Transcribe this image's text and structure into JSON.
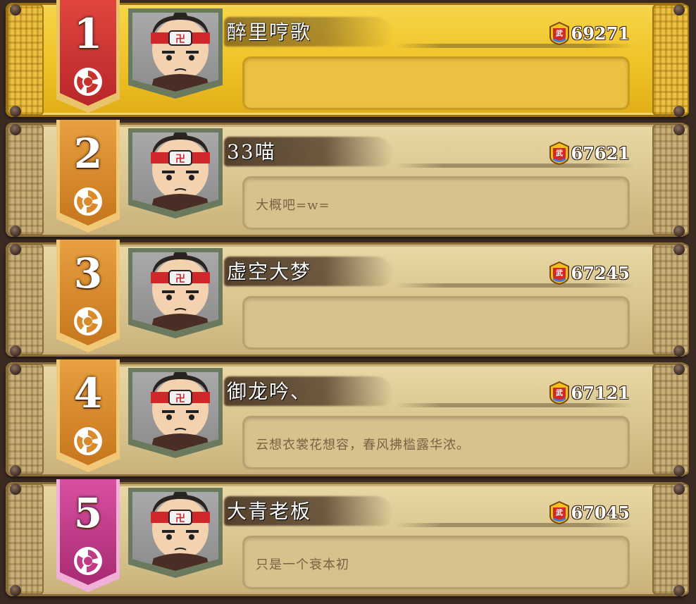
{
  "leaderboard": {
    "entries": [
      {
        "rank": "1",
        "name": "醉里哼歌",
        "score": "69271",
        "motto": "",
        "banner_color": "#c8322e",
        "banner_edge": "#e9c36a"
      },
      {
        "rank": "2",
        "name": "33喵",
        "score": "67621",
        "motto": "大概吧=w=",
        "banner_color": "#d98a2a",
        "banner_edge": "#f0c878"
      },
      {
        "rank": "3",
        "name": "虚空大梦",
        "score": "67245",
        "motto": "",
        "banner_color": "#d98a2a",
        "banner_edge": "#f0c878"
      },
      {
        "rank": "4",
        "name": "御龙吟、",
        "score": "67121",
        "motto": "云想衣裳花想容，春风拂槛露华浓。",
        "banner_color": "#d98a2a",
        "banner_edge": "#f0c878"
      },
      {
        "rank": "5",
        "name": "大青老板",
        "score": "67045",
        "motto": "只是一个衰本初",
        "banner_color": "#c03a86",
        "banner_edge": "#f0b0d8"
      }
    ],
    "score_icon": "wu-badge-icon",
    "rank_icon": "swirl-emblem-icon",
    "avatar_icon": "warrior-avatar-icon"
  }
}
